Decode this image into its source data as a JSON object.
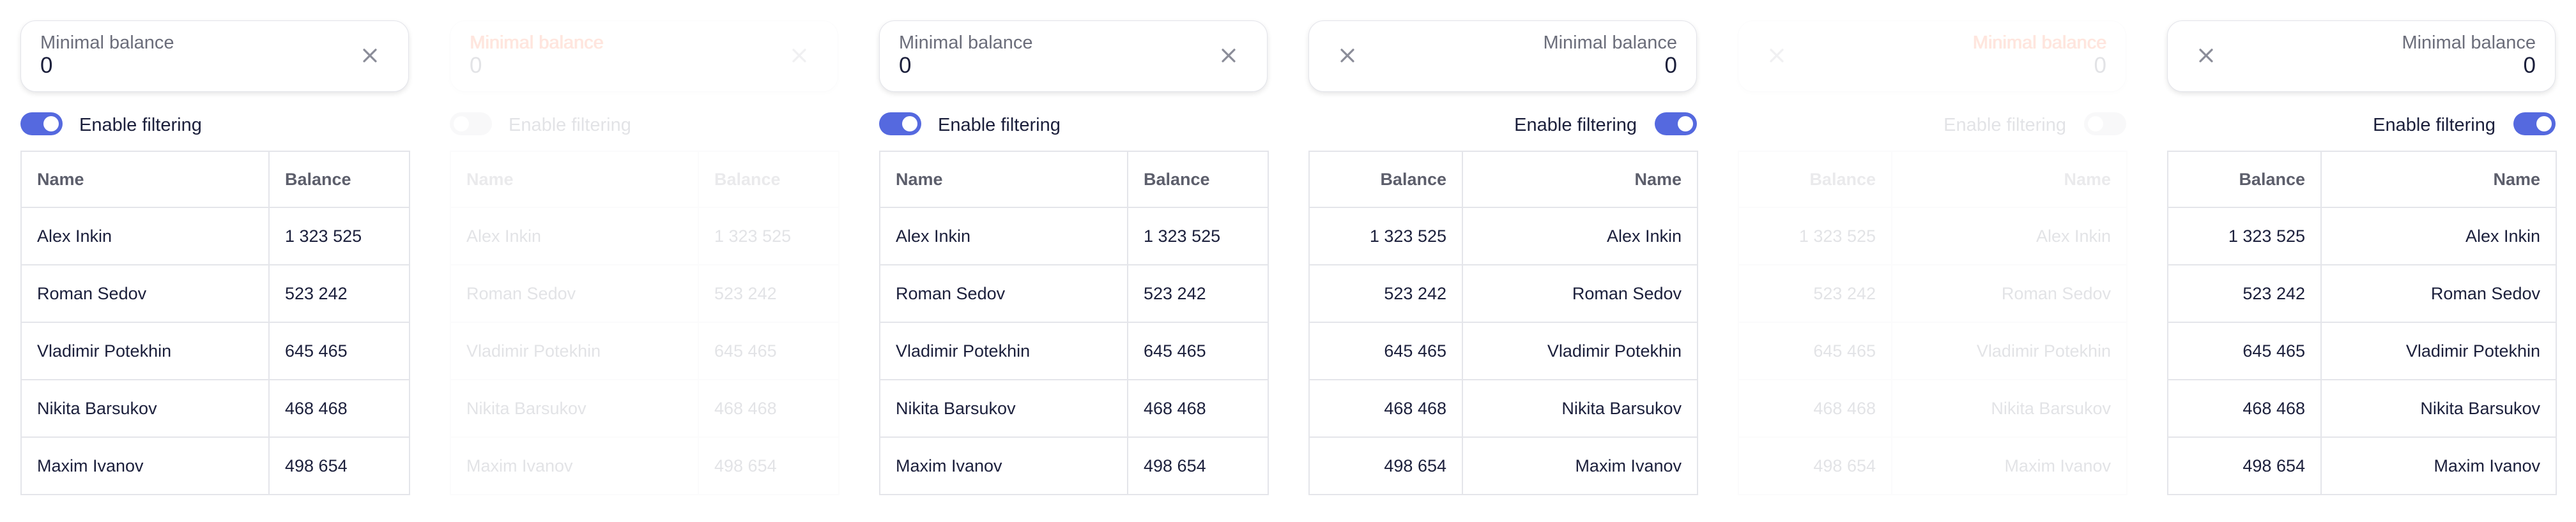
{
  "panels": [
    {
      "direction": "ltr",
      "disabled": false,
      "field": {
        "label": "Minimal balance",
        "value": "0",
        "clear_icon": "close-icon"
      },
      "toggle": {
        "label": "Enable filtering",
        "on": true
      },
      "table": {
        "columns": [
          "Name",
          "Balance"
        ],
        "rows": [
          [
            "Alex Inkin",
            "1 323 525"
          ],
          [
            "Roman Sedov",
            "523 242"
          ],
          [
            "Vladimir Potekhin",
            "645 465"
          ],
          [
            "Nikita Barsukov",
            "468 468"
          ],
          [
            "Maxim Ivanov",
            "498 654"
          ]
        ]
      }
    },
    {
      "direction": "ltr",
      "disabled": true,
      "field": {
        "label": "Minimal balance",
        "value": "0",
        "clear_icon": "close-icon"
      },
      "toggle": {
        "label": "Enable filtering",
        "on": false
      },
      "table": {
        "columns": [
          "Name",
          "Balance"
        ],
        "rows": [
          [
            "Alex Inkin",
            "1 323 525"
          ],
          [
            "Roman Sedov",
            "523 242"
          ],
          [
            "Vladimir Potekhin",
            "645 465"
          ],
          [
            "Nikita Barsukov",
            "468 468"
          ],
          [
            "Maxim Ivanov",
            "498 654"
          ]
        ]
      }
    },
    {
      "direction": "ltr",
      "disabled": false,
      "field": {
        "label": "Minimal balance",
        "value": "0",
        "clear_icon": "close-icon"
      },
      "toggle": {
        "label": "Enable filtering",
        "on": true
      },
      "table": {
        "columns": [
          "Name",
          "Balance"
        ],
        "rows": [
          [
            "Alex Inkin",
            "1 323 525"
          ],
          [
            "Roman Sedov",
            "523 242"
          ],
          [
            "Vladimir Potekhin",
            "645 465"
          ],
          [
            "Nikita Barsukov",
            "468 468"
          ],
          [
            "Maxim Ivanov",
            "498 654"
          ]
        ]
      }
    },
    {
      "direction": "rtl",
      "disabled": false,
      "field": {
        "label": "Minimal balance",
        "value": "0",
        "clear_icon": "close-icon"
      },
      "toggle": {
        "label": "Enable filtering",
        "on": true
      },
      "table": {
        "columns": [
          "Balance",
          "Name"
        ],
        "rows": [
          [
            "1 323 525",
            "Alex Inkin"
          ],
          [
            "523 242",
            "Roman Sedov"
          ],
          [
            "645 465",
            "Vladimir Potekhin"
          ],
          [
            "468 468",
            "Nikita Barsukov"
          ],
          [
            "498 654",
            "Maxim Ivanov"
          ]
        ]
      }
    },
    {
      "direction": "rtl",
      "disabled": true,
      "field": {
        "label": "Minimal balance",
        "value": "0",
        "clear_icon": "close-icon"
      },
      "toggle": {
        "label": "Enable filtering",
        "on": false
      },
      "table": {
        "columns": [
          "Balance",
          "Name"
        ],
        "rows": [
          [
            "1 323 525",
            "Alex Inkin"
          ],
          [
            "523 242",
            "Roman Sedov"
          ],
          [
            "645 465",
            "Vladimir Potekhin"
          ],
          [
            "468 468",
            "Nikita Barsukov"
          ],
          [
            "498 654",
            "Maxim Ivanov"
          ]
        ]
      }
    },
    {
      "direction": "rtl",
      "disabled": false,
      "field": {
        "label": "Minimal balance",
        "value": "0",
        "clear_icon": "close-icon"
      },
      "toggle": {
        "label": "Enable filtering",
        "on": true
      },
      "table": {
        "columns": [
          "Balance",
          "Name"
        ],
        "rows": [
          [
            "1 323 525",
            "Alex Inkin"
          ],
          [
            "523 242",
            "Roman Sedov"
          ],
          [
            "645 465",
            "Vladimir Potekhin"
          ],
          [
            "468 468",
            "Nikita Barsukov"
          ],
          [
            "498 654",
            "Maxim Ivanov"
          ]
        ]
      }
    }
  ],
  "colors": {
    "accent": "#5569df",
    "border": "#e4e5ea",
    "text": "#1b1f3b",
    "muted": "#6b6d7a",
    "disabled_label": "#ff2d00"
  }
}
